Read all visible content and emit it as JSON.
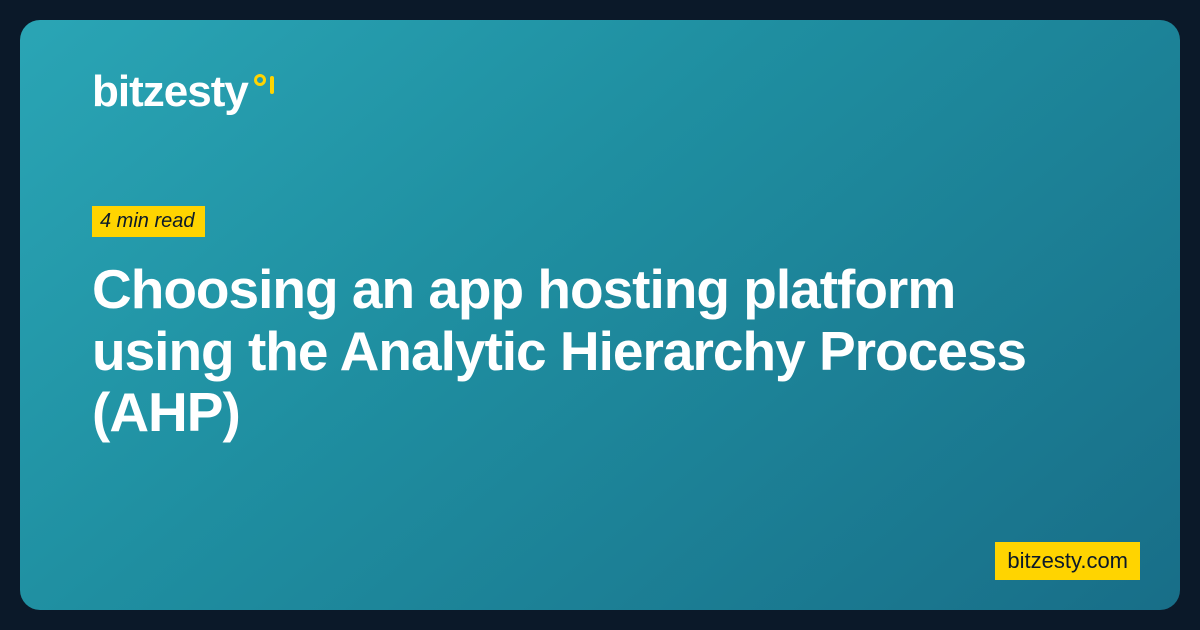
{
  "brand": {
    "name": "bitzesty"
  },
  "post": {
    "read_time": "4 min read",
    "title": "Choosing an app hosting platform using the Analytic Hierarchy Process (AHP)"
  },
  "site": {
    "domain": "bitzesty.com"
  }
}
